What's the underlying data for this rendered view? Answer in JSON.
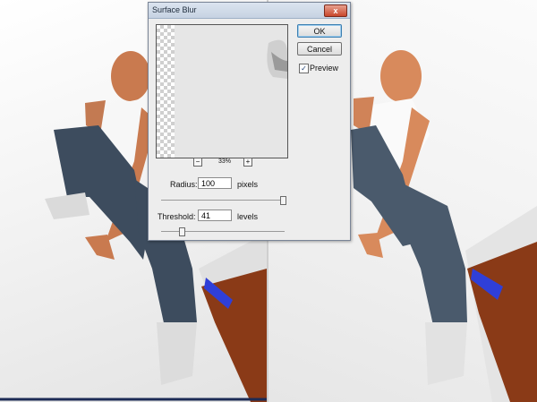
{
  "dialog": {
    "title": "Surface Blur",
    "close_glyph": "x",
    "ok_label": "OK",
    "cancel_label": "Cancel",
    "preview_label": "Preview",
    "preview_checked": true,
    "zoom_out_glyph": "−",
    "zoom_in_glyph": "+",
    "zoom_level": "33%",
    "radius": {
      "label": "Radius:",
      "value": "100",
      "unit": "pixels",
      "slider_fraction": 0.98
    },
    "threshold": {
      "label": "Threshold:",
      "value": "41",
      "unit": "levels",
      "slider_fraction": 0.16
    }
  },
  "colors": {
    "close_button": "#c9472c",
    "default_button_outline": "#3c7fb1",
    "floor_wood": "#8a3a17",
    "jeans": "#3d4c5e",
    "skin": "#d88a5c"
  },
  "icons": {
    "close": "close-icon",
    "zoom_out": "minus-icon",
    "zoom_in": "plus-icon",
    "checkbox": "check-icon"
  }
}
